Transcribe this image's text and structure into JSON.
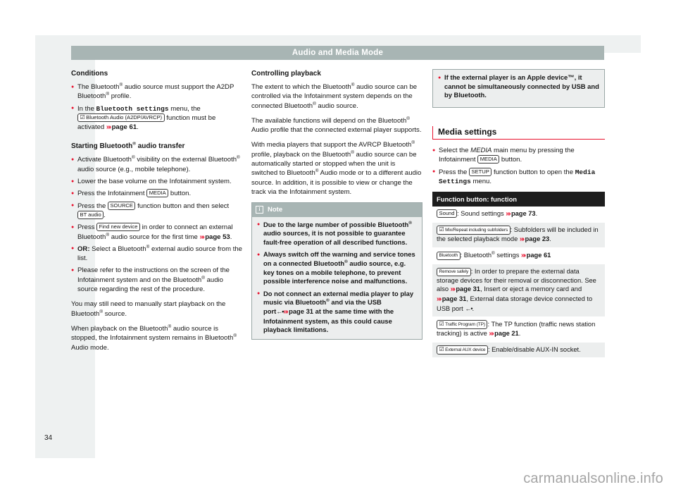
{
  "document": {
    "running_head": "Audio and Media Mode",
    "page_number": "34",
    "watermark": "carmanualsonline.info"
  },
  "colors": {
    "accent_red": "#e8112d",
    "head_bar": "#a8b5b4",
    "box_bg": "#eceeee",
    "table_head_bg": "#1d1d1d",
    "page_bg": "#eef1f1"
  },
  "column1": {
    "heading_conditions": "Conditions",
    "bullet1_a": "The Bluetooth",
    "bullet1_b": " audio source must support the A2DP Bluetooth",
    "bullet1_c": " profile.",
    "bullet2_a": "In the ",
    "bullet2_menu": "Bluetooth settings",
    "bullet2_b": " menu, the ",
    "bullet2_key": "Bluetooth Audio (A2DP/AVRCP)",
    "bullet2_c": " function must be activated ",
    "bullet2_ref": "page 61",
    "bullet2_d": ".",
    "heading_starting_a": "Starting Bluetooth",
    "heading_starting_b": " audio transfer",
    "b1_a": "Activate Bluetooth",
    "b1_b": " visibility on the external Bluetooth",
    "b1_c": " audio source (e.g., mobile telephone).",
    "b2": "Lower the base volume on the Infotainment system.",
    "b3_a": "Press the Infotainment ",
    "b3_key": "MEDIA",
    "b3_b": " button.",
    "b4_a": "Press the ",
    "b4_key1": "SOURCE",
    "b4_b": " function button and then select ",
    "b4_key2": "BT audio",
    "b4_c": ".",
    "b5_a": "Press ",
    "b5_key": "Find new device",
    "b5_b": " in order to connect an external Bluetooth",
    "b5_c": " audio source for the first time ",
    "b5_ref": "page 53",
    "b5_d": ".",
    "b6_strong": "OR:",
    "b6_a": " Select a Bluetooth",
    "b6_b": " external audio source from the list.",
    "b7_a": "Please refer to the instructions on the screen of the Infotainment system and on the Bluetooth",
    "b7_b": " audio source regarding the rest of the procedure.",
    "p1_a": "You may still need to manually start playback on the Bluetooth",
    "p1_b": " source.",
    "p2_a": "When playback on the Bluetooth",
    "p2_b": " audio source is stopped, the Infotainment system remains in Bluetooth",
    "p2_c": " Audio mode."
  },
  "column2": {
    "heading": "Controlling playback",
    "p1_a": "The extent to which the Bluetooth",
    "p1_b": " audio source can be controlled via the Infotainment system depends on the connected Bluetooth",
    "p1_c": " audio source.",
    "p2_a": "The available functions will depend on the Bluetooth",
    "p2_b": " Audio profile that the connected external player supports.",
    "p3_a": "With media players that support the AVRCP Bluetooth",
    "p3_b": " profile, playback on the Bluetooth",
    "p3_c": " audio source can be automatically started or stopped when the unit is switched to Bluetooth",
    "p3_d": " Audio mode or to a different audio source. In addition, it is possible to view or change the track via the Infotainment system.",
    "note": {
      "title": "Note",
      "icon": "info-icon",
      "n1_a": "Due to the large number of possible Bluetooth",
      "n1_b": " audio sources, it is not possible to guarantee fault-free operation of all described functions.",
      "n2_a": "Always switch off the warning and service tones on a connected Bluetooth",
      "n2_b": " audio source, e.g. key tones on a mobile telephone, to prevent possible interference noise and malfunctions.",
      "n3_a": "Do not connect an external media player to play music via Bluetooth",
      "n3_b": " and via the USB port",
      "n3_usb": "←•",
      "n3_ref": "page 31",
      "n3_c": " at the same time with the Infotainment system, as this could cause playback limitations."
    }
  },
  "column3": {
    "apple_note": {
      "a": "If the external player is an Apple device™, it cannot be simultaneously connected by USB and by Bluetooth."
    },
    "section_title": "Media settings",
    "b1_a": "Select the ",
    "b1_ital": "MEDIA",
    "b1_b": " main menu by pressing the Infotainment ",
    "b1_key": "MEDIA",
    "b1_c": " button.",
    "b2_a": "Press the ",
    "b2_key": "SETUP",
    "b2_b": " function button to open the ",
    "b2_menu": "Media Settings",
    "b2_c": " menu.",
    "table": {
      "header": "Function button: function",
      "rows": [
        {
          "key": "Sound",
          "checkbox": false,
          "text_a": ": Sound settings ",
          "ref": "page 73",
          "text_b": "."
        },
        {
          "key": "Mix/Repeat including subfolders",
          "checkbox": true,
          "text_a": ": Subfolders will be included in the selected playback mode ",
          "ref": "page 23",
          "text_b": "."
        },
        {
          "key": "Bluetooth",
          "checkbox": false,
          "text_a": ": Bluetooth",
          "reg": true,
          "text_mid": " settings ",
          "ref": "page 61",
          "text_b": ""
        },
        {
          "key": "Remove safely",
          "checkbox": false,
          "text_a": ": In order to prepare the external data storage devices for their removal or disconnection. See also ",
          "ref": "page 31",
          "text_b": ", Insert or eject a memory card and ",
          "ref2": "page 31",
          "text_c": ", External data storage device connected to USB port ",
          "usb": "←•",
          "text_d": "."
        },
        {
          "key": "Traffic Program (TP)",
          "checkbox": true,
          "text_a": ": The TP function (traffic news station tracking) is active ",
          "ref": "page 21",
          "text_b": "."
        },
        {
          "key": "External AUX device",
          "checkbox": true,
          "text_a": ": Enable/disable AUX-IN socket.",
          "ref": "",
          "text_b": ""
        }
      ]
    }
  }
}
